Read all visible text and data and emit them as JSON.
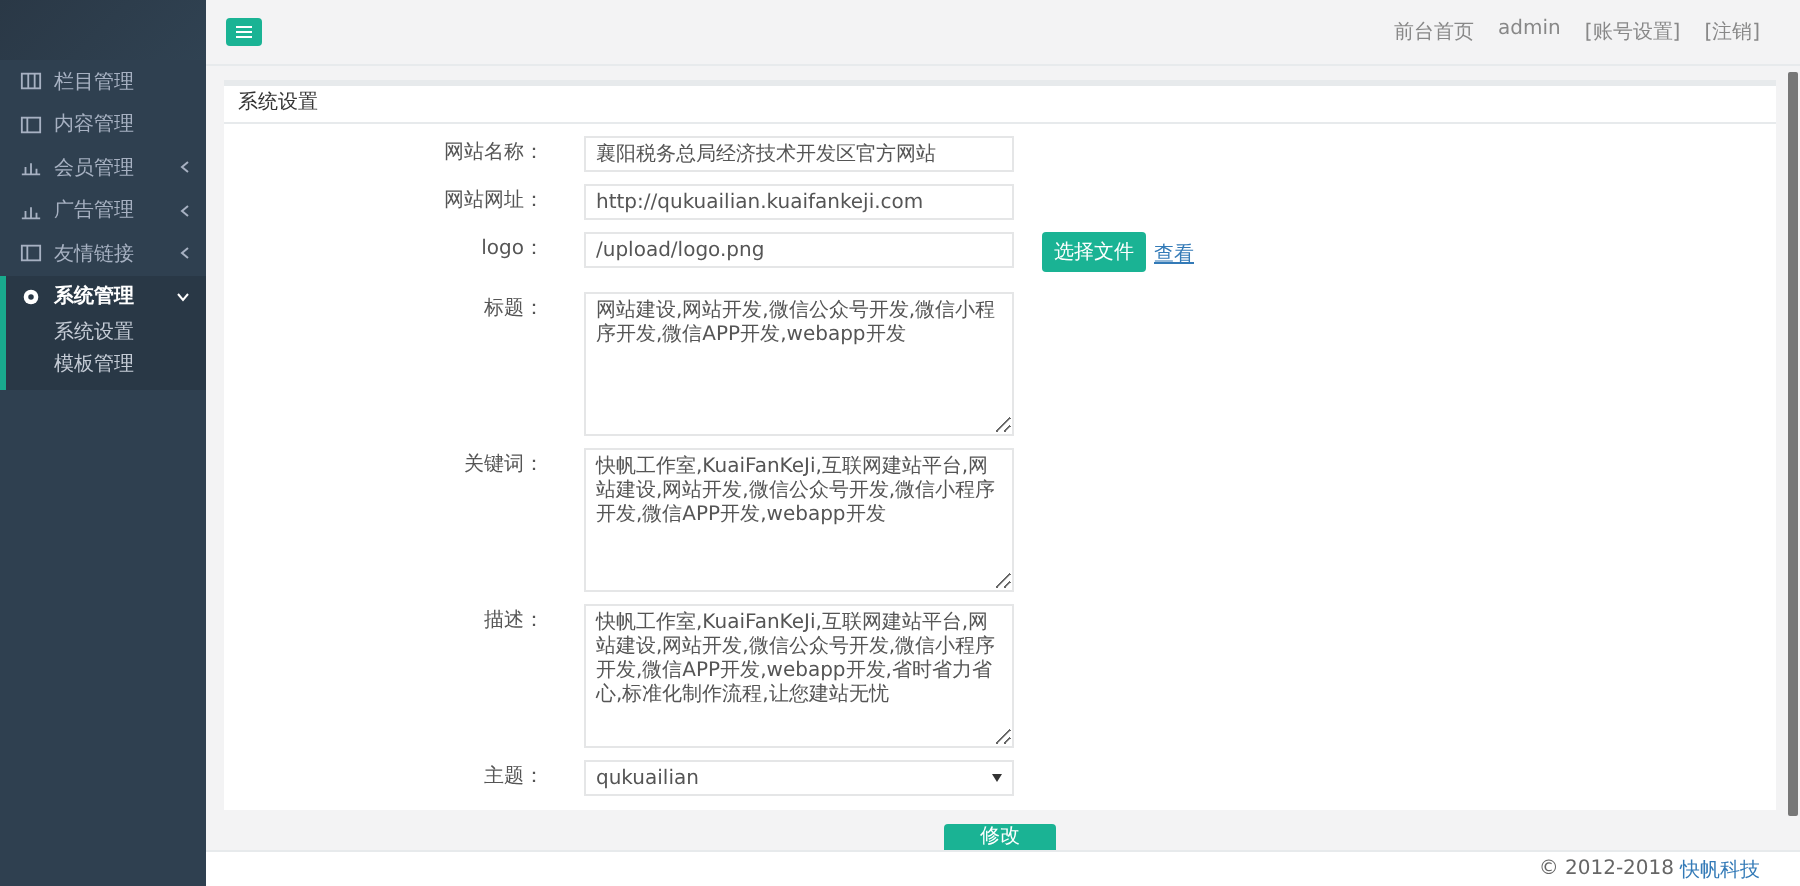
{
  "sidebar": {
    "items": [
      {
        "label": "栏目管理",
        "kind": "link"
      },
      {
        "label": "内容管理",
        "kind": "link"
      },
      {
        "label": "会员管理",
        "kind": "group",
        "expanded": false
      },
      {
        "label": "广告管理",
        "kind": "group",
        "expanded": false
      },
      {
        "label": "友情链接",
        "kind": "group",
        "expanded": false
      },
      {
        "label": "系统管理",
        "kind": "group",
        "expanded": true,
        "children": [
          {
            "label": "系统设置"
          },
          {
            "label": "模板管理"
          }
        ]
      }
    ]
  },
  "top_links": [
    "前台首页",
    "admin",
    "[账号设置]",
    "[注销]"
  ],
  "panel": {
    "title": "系统设置",
    "fields": [
      {
        "label": "网站名称：",
        "kind": "input",
        "value": "襄阳税务总局经济技术开发区官方网站"
      },
      {
        "label": "网站网址：",
        "kind": "input",
        "value": "http://qukuailian.kuaifankeji.com"
      },
      {
        "label": "logo：",
        "kind": "file",
        "value": "/upload/logo.png",
        "button": "选择文件",
        "link": "查看"
      },
      {
        "label": "标题：",
        "kind": "textarea",
        "value": "网站建设,网站开发,微信公众号开发,微信小程序开发,微信APP开发,webapp开发"
      },
      {
        "label": "关键词：",
        "kind": "textarea",
        "value": "快帆工作室,KuaiFanKeJi,互联网建站平台,网站建设,网站开发,微信公众号开发,微信小程序开发,微信APP开发,webapp开发"
      },
      {
        "label": "描述：",
        "kind": "textarea",
        "value": "快帆工作室,KuaiFanKeJi,互联网建站平台,网站建设,网站开发,微信公众号开发,微信小程序开发,微信APP开发,webapp开发,省时省力省心,标准化制作流程,让您建站无忧"
      },
      {
        "label": "主题：",
        "kind": "select",
        "value": "qukuailian"
      }
    ],
    "submit": "修改"
  },
  "footer": {
    "copyright": "© 2012-2018",
    "company": "快帆科技"
  }
}
